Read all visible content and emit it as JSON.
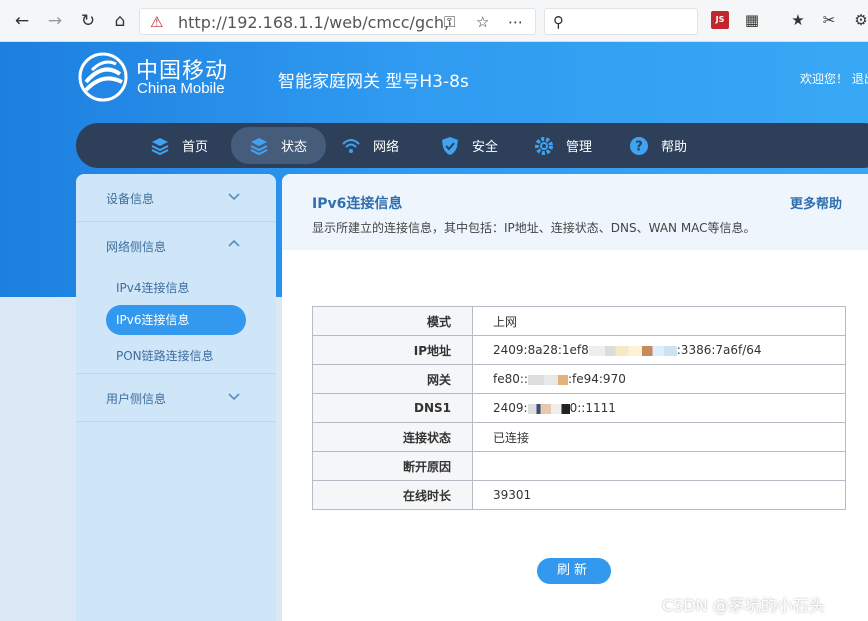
{
  "browser": {
    "url": "http://192.168.1.1/web/cmcc/gch,",
    "icons": [
      "back-icon",
      "forward-icon",
      "reload-icon",
      "home-icon",
      "blocked-shield-icon",
      "key-icon",
      "star-icon",
      "more-icon",
      "search-icon",
      "js-extension-icon",
      "grid-icon",
      "favorites-icon",
      "scissors-icon",
      "more-extensions-icon"
    ],
    "js_badge": "JS"
  },
  "header": {
    "logo_cn": "中国移动",
    "logo_en": "China Mobile",
    "product_title": "智能家庭网关 型号H3-8s",
    "welcome": "欢迎您！ 退出"
  },
  "topnav": {
    "items": [
      {
        "label": "首页",
        "icon": "layers-icon"
      },
      {
        "label": "状态",
        "icon": "layers-icon"
      },
      {
        "label": "网络",
        "icon": "wifi-icon"
      },
      {
        "label": "安全",
        "icon": "shield-icon"
      },
      {
        "label": "管理",
        "icon": "gear-icon"
      },
      {
        "label": "帮助",
        "icon": "help-icon"
      }
    ],
    "active_index": 1
  },
  "sidebar": {
    "groups": [
      {
        "label": "设备信息"
      },
      {
        "label": "网络侧信息",
        "subitems": [
          "IPv4连接信息",
          "IPv6连接信息",
          "PON链路连接信息"
        ]
      },
      {
        "label": "用户侧信息"
      }
    ],
    "active_subitem": "IPv6连接信息"
  },
  "main": {
    "title": "IPv6连接信息",
    "more_help": "更多帮助",
    "description": "显示所建立的连接信息，其中包括：IP地址、连接状态、DNS、WAN MAC等信息。",
    "rows": [
      {
        "key": "模式",
        "value": "上网"
      },
      {
        "key": "IP地址",
        "value_pre": "2409:8a28:1ef8",
        "value_post": ":3386:7a6f/64"
      },
      {
        "key": "网关",
        "value_pre": "fe80::",
        "value_post": ":fe94:970"
      },
      {
        "key": "DNS1",
        "value_pre": "2409:",
        "value_post": "0::1111"
      },
      {
        "key": "连接状态",
        "value": "已连接"
      },
      {
        "key": "断开原因",
        "value": ""
      },
      {
        "key": "在线时长",
        "value": "39301"
      }
    ],
    "refresh_label": "刷新"
  },
  "watermark": "CSDN @茅坑的小石头"
}
